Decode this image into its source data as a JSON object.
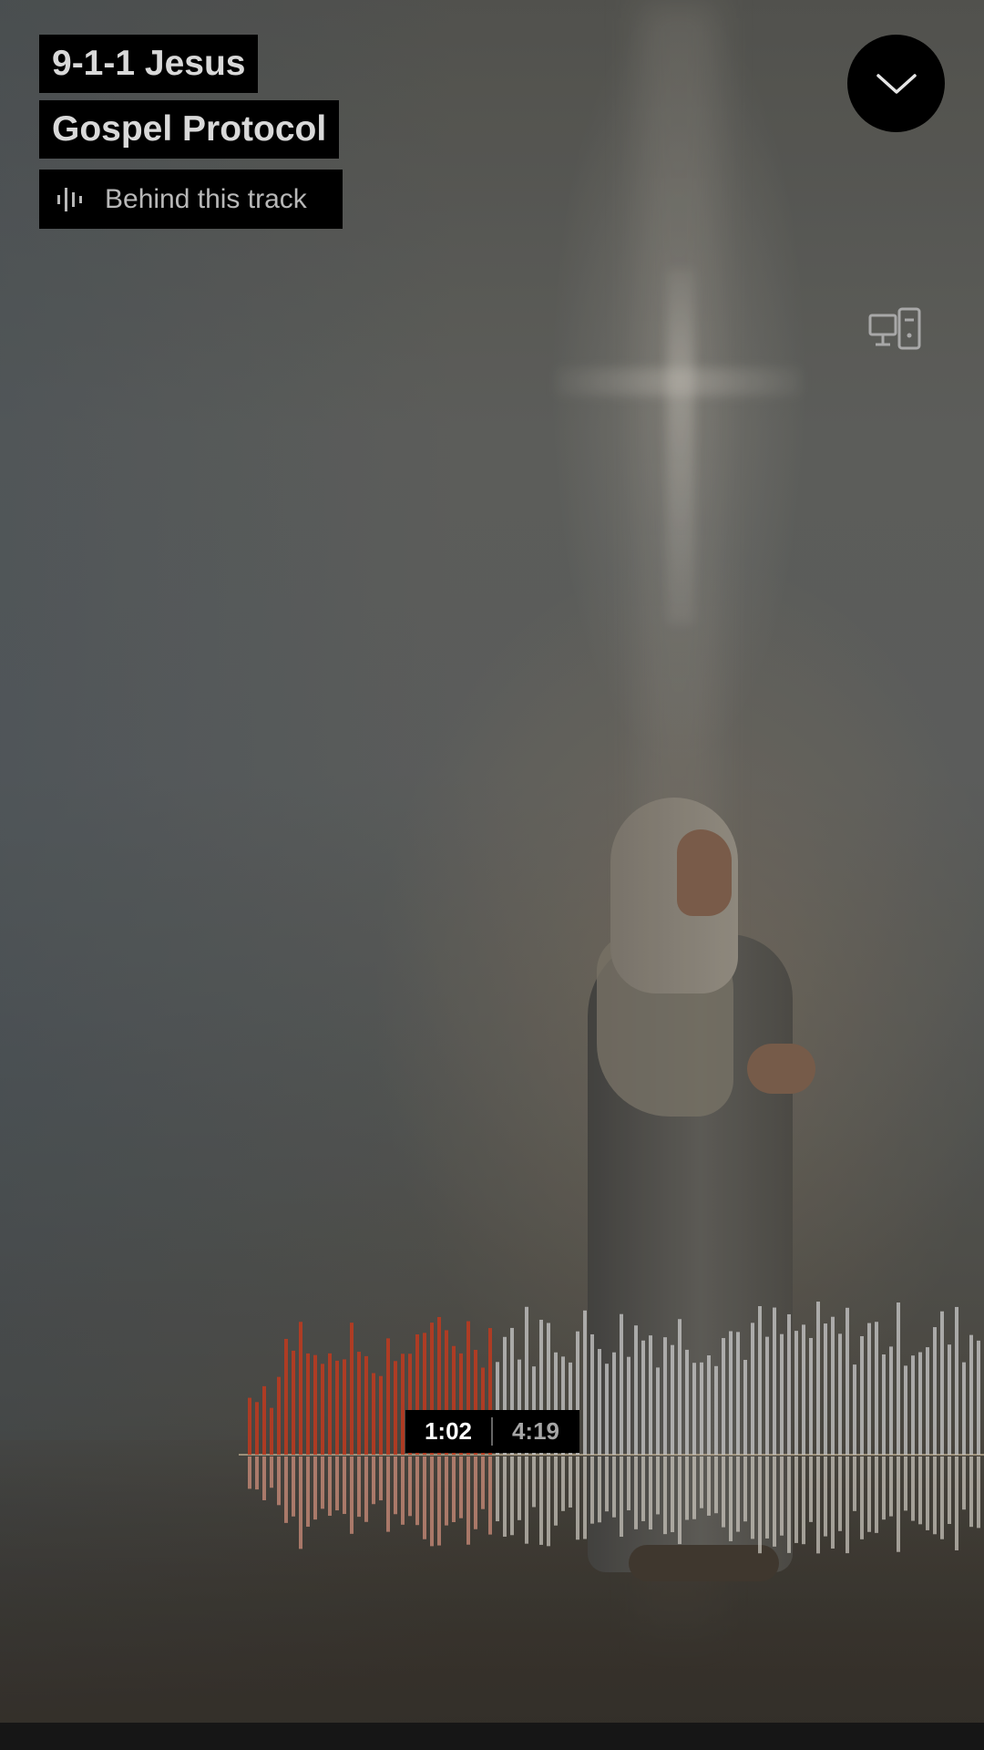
{
  "track": {
    "title": "9-1-1 Jesus",
    "artist": "Gospel Protocol",
    "behind_label": "Behind this track"
  },
  "controls": {
    "collapse_icon": "chevron-down-icon",
    "device_icon": "devices-icon",
    "behind_icon": "waveform-bars-icon"
  },
  "playback": {
    "current_time": "1:02",
    "total_time": "4:19",
    "played_color": "#c0391e",
    "unplayed_color": "#c9c9c9"
  },
  "artwork": {
    "description_icon": "cover-art-image"
  }
}
